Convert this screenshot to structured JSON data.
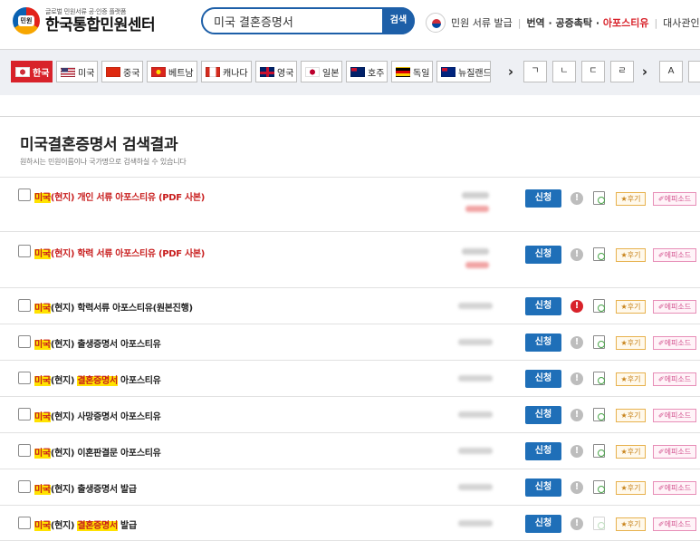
{
  "header": {
    "logo_sub": "글로벌 민원서류 공·인증 플랫폼",
    "logo_title": "한국통합민원센터",
    "logo_badge": "민원",
    "search_value": "미국 결혼증명서",
    "search_button": "검색",
    "util_links": {
      "issue": "민원 서류 발급",
      "translate": "번역 · 공증촉탁 · ",
      "apostille": "아포스티유",
      "embassy": "대사관인"
    }
  },
  "countries": [
    {
      "label": "한국",
      "flag": "kr",
      "active": true
    },
    {
      "label": "미국",
      "flag": "us"
    },
    {
      "label": "중국",
      "flag": "cn"
    },
    {
      "label": "베트남",
      "flag": "vn"
    },
    {
      "label": "캐나다",
      "flag": "ca"
    },
    {
      "label": "영국",
      "flag": "gb"
    },
    {
      "label": "일본",
      "flag": "jp"
    },
    {
      "label": "호주",
      "flag": "au"
    },
    {
      "label": "독일",
      "flag": "de"
    },
    {
      "label": "뉴질랜드",
      "flag": "nz"
    }
  ],
  "letters": [
    "ㄱ",
    "ㄴ",
    "ㄷ",
    "ㄹ",
    "A"
  ],
  "nav_arrow": "›",
  "results": {
    "title": "미국결혼증명서 검색결과",
    "subtitle": "원하시는 민원이름이나 국가명으로 검색하실 수 있습니다",
    "apply_label": "신청",
    "review_label": "★후기",
    "episode_label": "✐에피소드",
    "items": [
      {
        "prefix": "미국",
        "mid": "(현지) 개인 서류 아포스티유 (PDF 사본)",
        "highlight": "",
        "suffix": "",
        "red": true
      },
      {
        "prefix": "미국",
        "mid": "(현지) 학력 서류 아포스티유 (PDF 사본)",
        "highlight": "",
        "suffix": "",
        "red": true
      },
      {
        "prefix": "미국",
        "mid": "(현지) 학력서류 아포스티유(원본진행)",
        "highlight": "",
        "suffix": "",
        "red": false
      },
      {
        "prefix": "미국",
        "mid": "(현지) 출생증명서 아포스티유",
        "highlight": "",
        "suffix": "",
        "red": false
      },
      {
        "prefix": "미국",
        "mid": "(현지) ",
        "highlight": "결혼증명서",
        "suffix": " 아포스티유",
        "red": false
      },
      {
        "prefix": "미국",
        "mid": "(현지) 사망증명서 아포스티유",
        "highlight": "",
        "suffix": "",
        "red": false
      },
      {
        "prefix": "미국",
        "mid": "(현지) 이혼판결문 아포스티유",
        "highlight": "",
        "suffix": "",
        "red": false
      },
      {
        "prefix": "미국",
        "mid": "(현지) 출생증명서 발급",
        "highlight": "",
        "suffix": "",
        "red": false
      },
      {
        "prefix": "미국",
        "mid": "(현지) ",
        "highlight": "결혼증명서",
        "suffix": " 발급",
        "red": false
      }
    ]
  },
  "colors": {
    "brand_blue": "#1d5fa8",
    "accent_red": "#d8222a",
    "highlight_yellow": "#ffe200"
  }
}
